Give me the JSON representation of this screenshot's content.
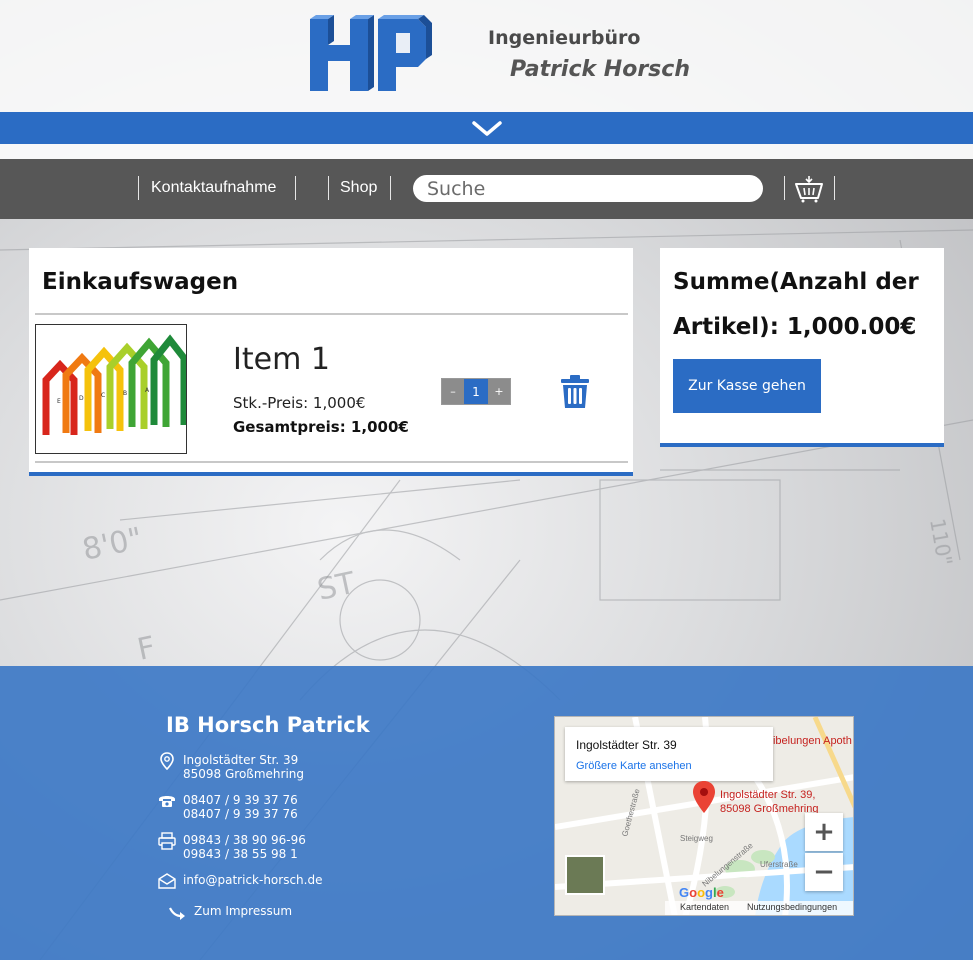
{
  "brand": {
    "line1": "Ingenieurbüro",
    "line2": "Patrick Horsch",
    "logo_text": "HP"
  },
  "nav": {
    "contact_label": "Kontaktaufnahme",
    "shop_label": "Shop",
    "search_placeholder": "Suche"
  },
  "cart": {
    "title": "Einkaufswagen",
    "items": [
      {
        "name": "Item 1",
        "unit_price": "Stk.-Preis: 1,000€",
        "total_price": "Gesamtpreis: 1,000€",
        "quantity": "1",
        "minus": "–",
        "plus": "+"
      }
    ]
  },
  "summary": {
    "line1": "Summe(Anzahl der",
    "line2": "Artikel): 1,000.00€",
    "checkout_label": "Zur Kasse gehen"
  },
  "footer": {
    "title": "IB Horsch Patrick",
    "address_line1": "Ingolstädter Str. 39",
    "address_line2": "85098 Großmehring",
    "phone1": "08407 / 9 39 37 76",
    "phone2": "08407 / 9 39 37 76",
    "fax1": "09843 / 38 90 96-96",
    "fax2": "09843 / 38 55 98 1",
    "email": "info@patrick-horsch.de",
    "imprint_label": "Zum Impressum"
  },
  "map": {
    "card_title": "Ingolstädter Str. 39",
    "card_link": "Größere Karte ansehen",
    "marker_line1": "Ingolstädter Str. 39,",
    "marker_line2": "85098 Großmehring",
    "zoom_in": "+",
    "zoom_out": "−",
    "map_data_label": "Kartendaten",
    "terms_label": "Nutzungsbedingungen",
    "provider": "Google",
    "street_labels": [
      "Goethestraße",
      "Steigweg",
      "Uferstraße",
      "Nibelungenstraße",
      "Nibelungen Apoth"
    ]
  },
  "colors": {
    "accent_blue": "#2b6cc4",
    "nav_grey": "#575757",
    "footer_blue": "#3a77c5"
  }
}
